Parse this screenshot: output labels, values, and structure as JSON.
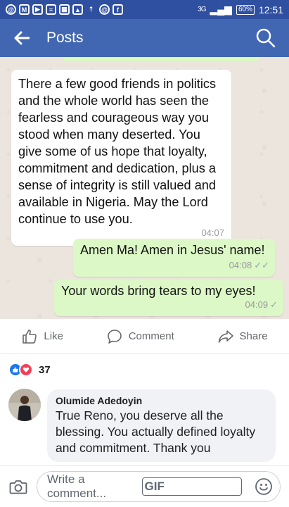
{
  "status_bar": {
    "time": "12:51",
    "battery": "60%",
    "network": "3G",
    "icons": [
      "at-icon",
      "mail-icon",
      "youtube-icon",
      "notification-icon",
      "image-icon",
      "download-icon",
      "upload-icon",
      "at-icon",
      "facebook-icon"
    ]
  },
  "app_bar": {
    "title": "Posts",
    "back_icon": "arrow-left-icon",
    "search_icon": "search-icon",
    "color": "#4267b2"
  },
  "chat": {
    "incoming": {
      "text": "There a few good friends in politics and the whole world has seen the fearless and courageous way you stood when many deserted. You give some of us hope that loyalty, commitment and dedication, plus a sense of integrity is still valued and available in Nigeria. May the Lord continue to use you.",
      "time": "04:07"
    },
    "outgoing": [
      {
        "text": "Amen Ma! Amen in Jesus' name!",
        "time": "04:08",
        "status": "read"
      },
      {
        "text": "Your words bring tears to my eyes!",
        "time": "04:09",
        "status": "sent"
      }
    ]
  },
  "actions": {
    "like": "Like",
    "comment": "Comment",
    "share": "Share"
  },
  "reactions": {
    "count": "37",
    "types": [
      "like",
      "love"
    ]
  },
  "comment": {
    "author": "Olumide Adedoyin",
    "text": "True Reno, you deserve all the blessing. You actually defined loyalty and commitment. Thank you"
  },
  "composer": {
    "placeholder": "Write a comment...",
    "gif_label": "GIF"
  }
}
